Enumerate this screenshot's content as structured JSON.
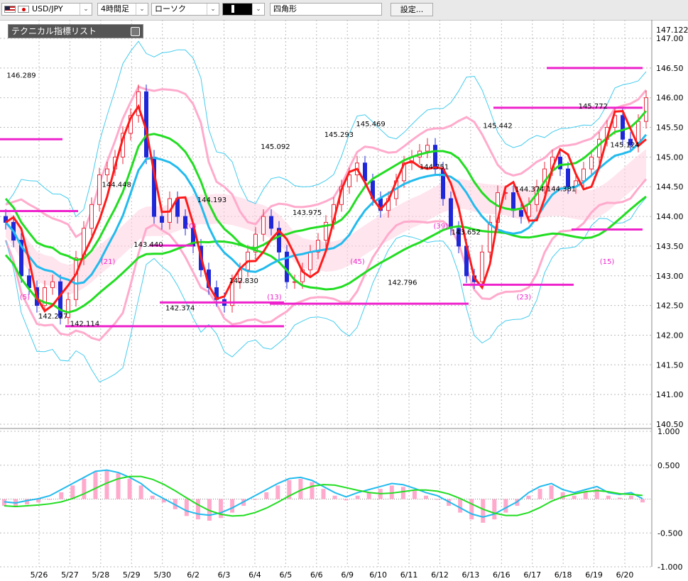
{
  "toolbar": {
    "symbol": "USD/JPY",
    "timeframe": "4時間足",
    "chart_type": "ローソク",
    "tool_icon": "pen-icon",
    "shape": "四角形",
    "settings": "設定..."
  },
  "indicator_panel": {
    "title": "テクニカル指標リスト"
  },
  "colors": {
    "bull": "#e8283c",
    "bear": "#1e28d8",
    "ma_fast": "#ff1a1a",
    "ma_green": "#22dd22",
    "ma_cyan": "#22bbee",
    "bb_pink": "#ffaacc",
    "bb_blue": "#44ccee",
    "magenta": "#ee22cc",
    "osc_pos": "#ffaacc"
  },
  "chart_data": {
    "type": "line",
    "price_axis": {
      "min": 140.5,
      "max": 147.0,
      "ticks": [
        "147.00",
        "146.50",
        "146.00",
        "145.50",
        "145.00",
        "144.50",
        "144.00",
        "143.50",
        "143.00",
        "142.50",
        "142.00",
        "141.50",
        "141.00",
        "140.50"
      ]
    },
    "current_price": "147.122",
    "x_labels": [
      "5/26",
      "5/27",
      "5/28",
      "5/29",
      "5/30",
      "6/2",
      "6/3",
      "6/4",
      "6/5",
      "6/6",
      "6/9",
      "6/10",
      "6/11",
      "6/12",
      "6/13",
      "6/16",
      "6/17",
      "6/18",
      "6/19",
      "6/20"
    ],
    "price_labels": [
      {
        "text": "146.289",
        "price": 146.29
      },
      {
        "text": "142.227",
        "price": 142.23
      },
      {
        "text": "142.114",
        "price": 142.11
      },
      {
        "text": "144.448",
        "price": 144.45
      },
      {
        "text": "143.440",
        "price": 143.44
      },
      {
        "text": "142.374",
        "price": 142.37
      },
      {
        "text": "144.193",
        "price": 144.19
      },
      {
        "text": "142.830",
        "price": 142.83
      },
      {
        "text": "145.092",
        "price": 145.09
      },
      {
        "text": "143.975",
        "price": 143.98
      },
      {
        "text": "145.293",
        "price": 145.29
      },
      {
        "text": "145.469",
        "price": 145.47
      },
      {
        "text": "142.796",
        "price": 142.8
      },
      {
        "text": "144.751",
        "price": 144.75
      },
      {
        "text": "143.652",
        "price": 143.65
      },
      {
        "text": "145.442",
        "price": 145.44
      },
      {
        "text": "144.374",
        "price": 144.37
      },
      {
        "text": "144.381",
        "price": 144.38
      },
      {
        "text": "145.772",
        "price": 145.77
      },
      {
        "text": "145.124",
        "price": 145.12
      }
    ],
    "count_labels": [
      "(5)",
      "(21)",
      "(0)",
      "(13)",
      "(45)",
      "(39)",
      "(23)",
      "(15)"
    ],
    "levels": [
      145.3,
      144.09,
      143.51,
      142.55,
      142.15,
      142.53,
      142.85,
      143.78,
      145.83,
      146.5
    ],
    "close": [
      143.9,
      143.6,
      143.0,
      142.8,
      142.5,
      142.8,
      142.9,
      142.3,
      142.6,
      143.3,
      143.8,
      144.2,
      144.7,
      144.8,
      145.0,
      145.4,
      145.7,
      146.1,
      145.0,
      144.0,
      143.9,
      144.3,
      144.0,
      143.8,
      143.5,
      143.1,
      142.8,
      142.6,
      142.5,
      142.9,
      143.1,
      143.4,
      143.7,
      144.0,
      143.8,
      143.4,
      142.9,
      142.9,
      143.1,
      143.4,
      143.6,
      143.9,
      144.2,
      144.5,
      144.7,
      144.9,
      144.6,
      144.3,
      144.1,
      144.3,
      144.6,
      144.9,
      145.0,
      145.1,
      145.2,
      144.8,
      144.3,
      143.8,
      143.5,
      143.0,
      142.9,
      143.4,
      143.9,
      144.4,
      144.4,
      144.1,
      144.0,
      144.2,
      144.5,
      144.8,
      145.0,
      144.8,
      144.5,
      144.6,
      144.8,
      145.0,
      145.3,
      145.5,
      145.7,
      145.3,
      145.2,
      145.6,
      146.0
    ]
  },
  "osc_data": {
    "type": "histogram",
    "axis": {
      "min": -1.0,
      "max": 1.0,
      "ticks": [
        "1.000",
        "0.500",
        "-0.500",
        "-1.000"
      ]
    },
    "values": [
      -0.1,
      -0.12,
      -0.08,
      -0.05,
      0.0,
      0.1,
      0.2,
      0.3,
      0.4,
      0.42,
      0.38,
      0.3,
      0.2,
      0.05,
      -0.05,
      -0.15,
      -0.25,
      -0.3,
      -0.32,
      -0.28,
      -0.2,
      -0.1,
      0.0,
      0.1,
      0.2,
      0.28,
      0.3,
      0.25,
      0.15,
      0.05,
      -0.02,
      0.05,
      0.1,
      0.15,
      0.2,
      0.18,
      0.12,
      0.05,
      0.0,
      -0.1,
      -0.2,
      -0.3,
      -0.35,
      -0.3,
      -0.2,
      -0.1,
      0.05,
      0.15,
      0.2,
      0.1,
      0.05,
      0.1,
      0.15,
      0.05,
      0.02,
      0.05,
      -0.05
    ]
  }
}
